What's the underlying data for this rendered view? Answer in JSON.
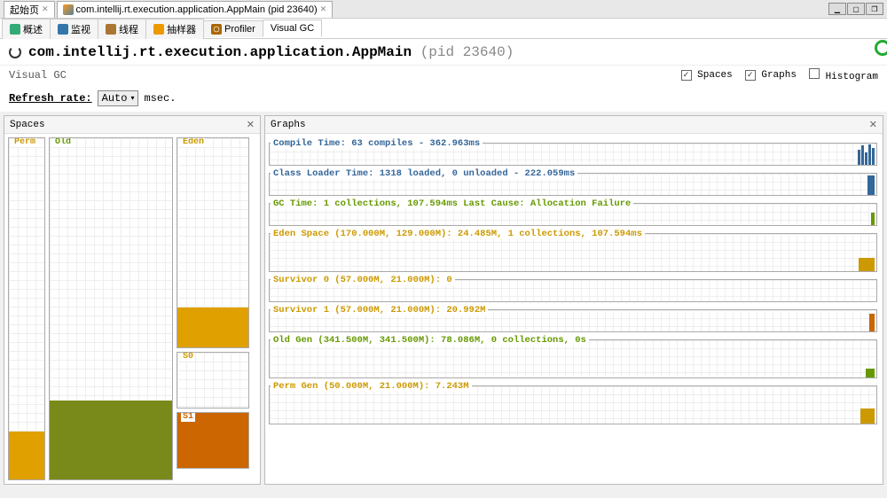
{
  "topTabs": {
    "start": "起始页",
    "main": "com.intellij.rt.execution.application.AppMain (pid 23640)"
  },
  "subTabs": {
    "overview": "概述",
    "monitor": "监视",
    "threads": "线程",
    "sampler": "抽样器",
    "profiler": "Profiler",
    "visualgc": "Visual GC"
  },
  "title": {
    "main": "com.intellij.rt.execution.application.AppMain",
    "pid": "(pid 23640)"
  },
  "cfg": {
    "panelName": "Visual GC",
    "spaces": "Spaces",
    "graphs": "Graphs",
    "histogram": "Histogram"
  },
  "refresh": {
    "label": "Refresh rate:",
    "value": "Auto",
    "unit": "msec."
  },
  "spaces": {
    "header": "Spaces",
    "perm": "Perm",
    "old": "Old",
    "eden": "Eden",
    "s0": "S0",
    "s1": "S1"
  },
  "graphs": {
    "header": "Graphs",
    "compile": "Compile Time: 63 compiles - 362.963ms",
    "loader": "Class Loader Time: 1318 loaded, 0 unloaded - 222.059ms",
    "gc": "GC Time: 1 collections, 107.594ms Last Cause: Allocation Failure",
    "eden": "Eden Space (170.000M, 129.000M): 24.485M, 1 collections, 107.594ms",
    "surv0": "Survivor 0 (57.000M, 21.000M): 0",
    "surv1": "Survivor 1 (57.000M, 21.000M): 20.992M",
    "old": "Old Gen (341.500M, 341.500M): 78.086M, 0 collections, 0s",
    "perm": "Perm Gen (50.000M, 21.000M): 7.243M"
  },
  "chart_data": {
    "type": "bar",
    "title": "JVM Memory Spaces",
    "series": [
      {
        "name": "Perm Gen",
        "capacity_mb": 21.0,
        "max_mb": 50.0,
        "used_mb": 7.243,
        "fill_pct": 14
      },
      {
        "name": "Old Gen",
        "capacity_mb": 341.5,
        "max_mb": 341.5,
        "used_mb": 78.086,
        "fill_pct": 23
      },
      {
        "name": "Eden Space",
        "capacity_mb": 129.0,
        "max_mb": 170.0,
        "used_mb": 24.485,
        "fill_pct": 19
      },
      {
        "name": "Survivor 0",
        "capacity_mb": 21.0,
        "max_mb": 57.0,
        "used_mb": 0,
        "fill_pct": 0
      },
      {
        "name": "Survivor 1",
        "capacity_mb": 21.0,
        "max_mb": 57.0,
        "used_mb": 20.992,
        "fill_pct": 100
      }
    ],
    "metrics": {
      "compiles": 63,
      "compile_time_ms": 362.963,
      "classes_loaded": 1318,
      "classes_unloaded": 0,
      "loader_time_ms": 222.059,
      "gc_collections": 1,
      "gc_time_ms": 107.594,
      "gc_last_cause": "Allocation Failure"
    }
  }
}
